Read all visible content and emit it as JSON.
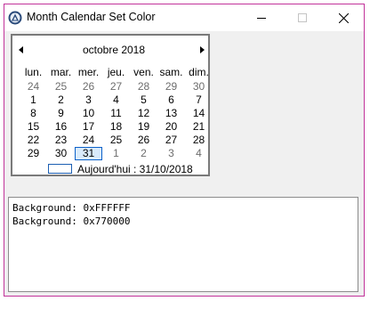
{
  "window": {
    "title": "Month Calendar Set Color",
    "controls": {
      "minimize": "minimize",
      "maximize": "maximize",
      "close": "close"
    }
  },
  "calendar": {
    "month_title": "octobre 2018",
    "weekdays": [
      "lun.",
      "mar.",
      "mer.",
      "jeu.",
      "ven.",
      "sam.",
      "dim."
    ],
    "weeks": [
      [
        "24",
        "25",
        "26",
        "27",
        "28",
        "29",
        "30"
      ],
      [
        "1",
        "2",
        "3",
        "4",
        "5",
        "6",
        "7"
      ],
      [
        "8",
        "9",
        "10",
        "11",
        "12",
        "13",
        "14"
      ],
      [
        "15",
        "16",
        "17",
        "18",
        "19",
        "20",
        "21"
      ],
      [
        "22",
        "23",
        "24",
        "25",
        "26",
        "27",
        "28"
      ],
      [
        "29",
        "30",
        "31",
        "1",
        "2",
        "3",
        "4"
      ]
    ],
    "selected_day": "31",
    "today_label": "Aujourd'hui : 31/10/2018"
  },
  "log": {
    "lines": [
      "Background: 0xFFFFFF",
      "Background: 0x770000"
    ]
  },
  "colors": {
    "window_border": "#c2339a",
    "today_outline": "#0b61c9"
  }
}
